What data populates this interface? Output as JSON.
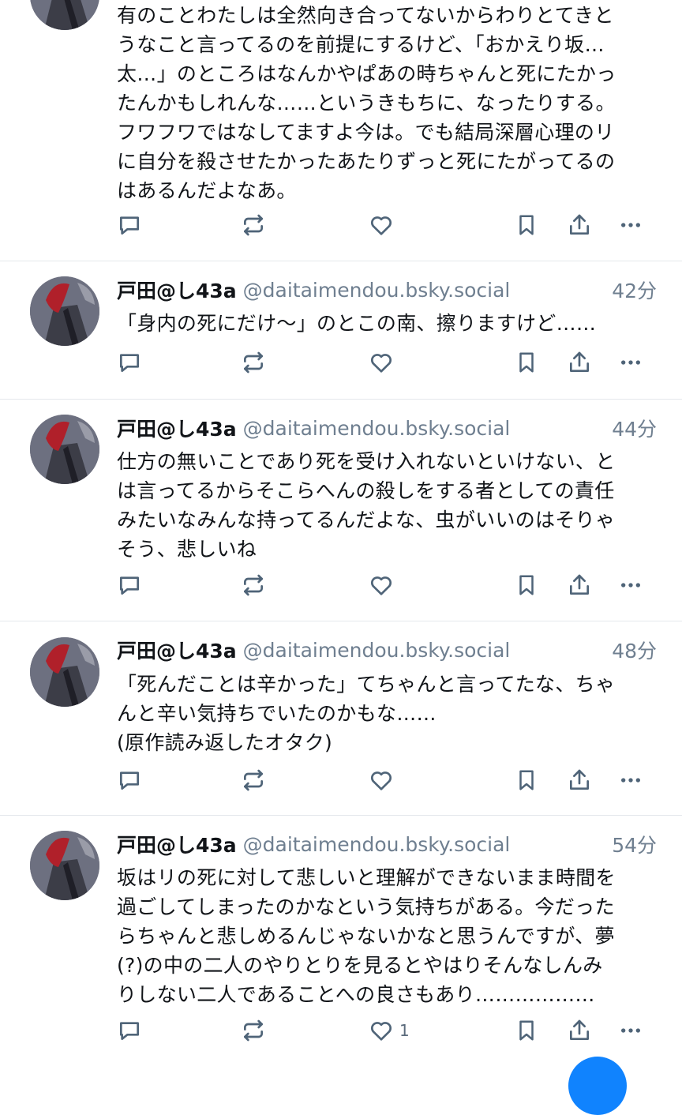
{
  "posts": [
    {
      "text": "有のことわたしは全然向き合ってないからわりとてきと\nうなこと言ってるのを前提にするけど、「おかえり坂…\n太…」のところはなんかやぱあの時ちゃんと死にたかっ\nたんかもしれんな……というきもちに、なったりする。\nフワフワではなしてますよ今は。でも結局深層心理のリ\nに自分を殺させたかったあたりずっと死にたがってるの\nはあるんだよなあ。",
      "like_count": ""
    },
    {
      "name": "戸田@し43a",
      "handle": "@daitaimendou.bsky.social",
      "time": "42分",
      "text": "「身内の死にだけ〜」のとこの南、擦りますけど……",
      "like_count": ""
    },
    {
      "name": "戸田@し43a",
      "handle": "@daitaimendou.bsky.social",
      "time": "44分",
      "text": "仕方の無いことであり死を受け入れないといけない、と\nは言ってるからそこらへんの殺しをする者としての責任\nみたいなみんな持ってるんだよな、虫がいいのはそりゃ\nそう、悲しいね",
      "like_count": ""
    },
    {
      "name": "戸田@し43a",
      "handle": "@daitaimendou.bsky.social",
      "time": "48分",
      "text": "「死んだことは辛かった」てちゃんと言ってたな、ちゃ\nんと辛い気持ちでいたのかもな……\n(原作読み返したオタク)",
      "like_count": ""
    },
    {
      "name": "戸田@し43a",
      "handle": "@daitaimendou.bsky.social",
      "time": "54分",
      "text": "坂はリの死に対して悲しいと理解ができないまま時間を\n過ごしてしまったのかなという気持ちがある。今だった\nらちゃんと悲しめるんじゃないかなと思うんですが、夢\n(?)の中の二人のやりとりを見るとやはりそんなしんみ\nりしない二人であることへの良さもあり………………",
      "like_count": "1"
    }
  ],
  "icons": {
    "reply": "reply-icon",
    "repost": "repost-icon",
    "like": "heart-icon",
    "bookmark": "bookmark-icon",
    "share": "share-icon",
    "more": "more-icon"
  },
  "colors": {
    "accent": "#1083fe",
    "icon": "#4f6478",
    "muted_text": "#6f7f90",
    "divider": "#e4e8ec"
  }
}
